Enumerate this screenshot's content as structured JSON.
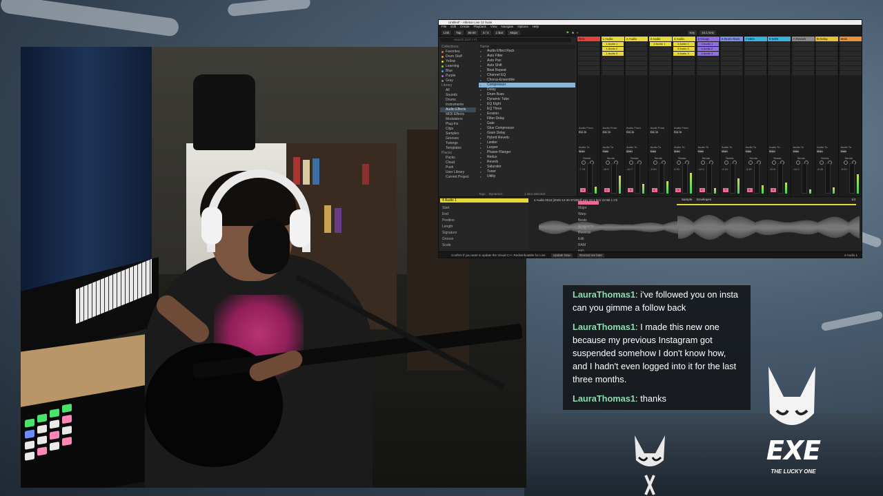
{
  "daw": {
    "title": "Untitled* - Ableton Live 12 Suite",
    "menu": [
      "File",
      "Edit",
      "Create",
      "Playback",
      "View",
      "Navigate",
      "Options",
      "Help"
    ],
    "transport": {
      "link": "Link",
      "tap": "Tap",
      "tempo": "80.00",
      "time_sig": "4 / 4",
      "loop_length": "1 Bar",
      "key": "Major",
      "scale_mode": "Key",
      "sample_rate": "44.1 kHz"
    },
    "browser": {
      "search_placeholder": "Search (Ctrl + F)",
      "collections_header": "Collections",
      "collections": [
        {
          "label": "Favorites",
          "color": "#e36c4a"
        },
        {
          "label": "Drum Stuff",
          "color": "#e3a13b"
        },
        {
          "label": "Yellow",
          "color": "#e3d43b"
        },
        {
          "label": "Learning",
          "color": "#7fd04f"
        },
        {
          "label": "Blue",
          "color": "#4f9ed0"
        },
        {
          "label": "Purple",
          "color": "#a46bd6"
        },
        {
          "label": "Gray",
          "color": "#8a8a8a"
        }
      ],
      "library_header": "Library",
      "library": [
        "All",
        "Sounds",
        "Drums",
        "Instruments",
        "Audio Effects",
        "MIDI Effects",
        "Modulators",
        "Plug-Ins",
        "Clips",
        "Samples",
        "Grooves",
        "Tunings",
        "Templates"
      ],
      "places_header": "Places",
      "places": [
        "Packs",
        "Cloud",
        "Push",
        "User Library",
        "Current Project"
      ],
      "list_header": "Name",
      "items": [
        "Audio Effect Rack",
        "Auto Filter",
        "Auto Pan",
        "Auto Shift",
        "Beat Repeat",
        "Channel EQ",
        "Chorus-Ensemble",
        "Compressor",
        "Delay",
        "Drum Buss",
        "Dynamic Tube",
        "EQ Eight",
        "EQ Three",
        "Erosion",
        "Filter Delay",
        "Gate",
        "Glue Compressor",
        "Grain Delay",
        "Hybrid Reverb",
        "Limiter",
        "Looper",
        "Phaser-Flanger",
        "Redux",
        "Reverb",
        "Saturator",
        "Tuner",
        "Utility"
      ],
      "selected_item": "Compressor",
      "footer": "1 item selected",
      "tags": "Tags",
      "tag_value": "Dynamics"
    },
    "tracks": [
      {
        "name": "Drm",
        "color": "#e0433d"
      },
      {
        "name": "1 Audio",
        "color": "#e8d93a"
      },
      {
        "name": "2 Audio",
        "color": "#e8d93a"
      },
      {
        "name": "3 Audio",
        "color": "#e8d93a"
      },
      {
        "name": "4 Audio",
        "color": "#e8d93a"
      },
      {
        "name": "5 Group",
        "color": "#8e6fe0"
      },
      {
        "name": "6 Drum Rack",
        "color": "#7e8fe8"
      },
      {
        "name": "7 MIDI",
        "color": "#39b3e0"
      },
      {
        "name": "8 MIDI",
        "color": "#39b3e0"
      },
      {
        "name": "A Reverb",
        "color": "#8a8a8a"
      },
      {
        "name": "B Delay",
        "color": "#e8c13a"
      },
      {
        "name": "Main",
        "color": "#e8943a"
      }
    ],
    "clip_labels": [
      "1 Audio 1",
      "2 Audio 1",
      "3 Audio 1",
      "4 Audio 1",
      "1 Audio 2",
      "3 Audio 2",
      "4 Audio 2",
      "1 Audio 3",
      "3 Audio 3",
      "4 Audio 3"
    ],
    "mixer": {
      "audio_from": "Audio From",
      "ext_in": "Ext. In",
      "monitor": "Monitor",
      "in_auto_off": "In Auto Off",
      "audio_to": "Audio To",
      "main": "Main",
      "sends": "Sends",
      "volumes": [
        "-7.76",
        "-16.5",
        "-10.7",
        "-9.60",
        "0.00",
        "-12.0",
        "-5.16",
        "-3.39",
        "-10.5",
        "-14.0",
        "-8.40",
        "-6.00"
      ]
    },
    "clip_detail": {
      "clip_name": "4 Audio 1",
      "file_info": "4 Audio 0015 [2025-12-30 072834].wav  44.1 kHz  24 Bit  1 Ch",
      "tabs": [
        "Sample",
        "Envelopes"
      ],
      "fields": [
        "Start",
        "End",
        "Position",
        "Length",
        "Signature",
        "Groove",
        "Scale",
        "Major",
        "Warp",
        "Beats",
        "Transients",
        "Reverse",
        "Edit",
        "RAM",
        "HiQ",
        "Fade"
      ],
      "bpm": "80.00",
      "page": "1/4"
    },
    "status": {
      "message": "Confirm if you want to update the Visual C++ Redistributable for Live.",
      "update_button": "Update Now",
      "remind_button": "Remind me later",
      "track_readout": "4-Audio 1"
    }
  },
  "chat": {
    "messages": [
      {
        "user": "LauraThomas1",
        "text": "i've followed you on insta can you gimme a follow back"
      },
      {
        "user": "LauraThomas1",
        "text": "I made this new one because my previous Instagram got suspended somehow I don't know how, and I hadn't even logged into it for the last three months."
      },
      {
        "user": "LauraThomas1",
        "text": "thanks"
      }
    ]
  },
  "brand": {
    "name": "EXE",
    "tagline": "THE LUCKY ONE"
  }
}
